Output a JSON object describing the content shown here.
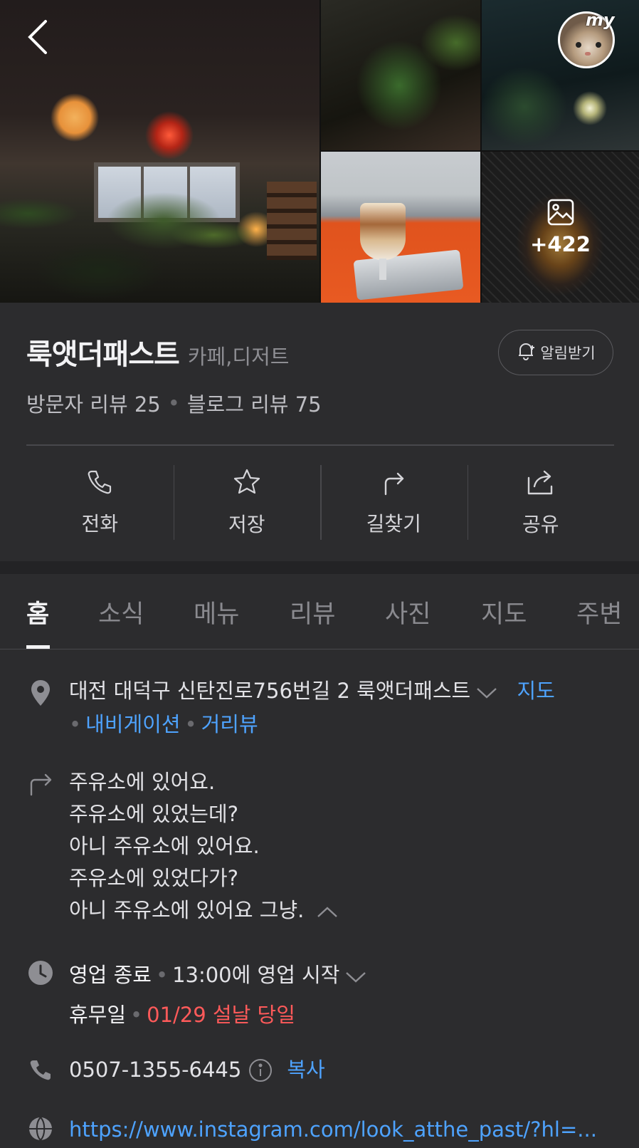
{
  "header": {
    "back_icon": "chevron-left-icon",
    "profile_badge": "my",
    "more_photos_count": "+422",
    "more_photos_icon": "image-icon"
  },
  "place": {
    "name": "룩앳더패스트",
    "category": "카페,디저트",
    "alarm_label": "알림받기",
    "visitor_reviews": "방문자 리뷰 25",
    "blog_reviews": "블로그 리뷰 75"
  },
  "actions": [
    {
      "label": "전화",
      "icon": "phone-icon"
    },
    {
      "label": "저장",
      "icon": "star-icon"
    },
    {
      "label": "길찾기",
      "icon": "directions-icon"
    },
    {
      "label": "공유",
      "icon": "share-icon"
    }
  ],
  "tabs": [
    {
      "label": "홈",
      "active": true
    },
    {
      "label": "소식"
    },
    {
      "label": "메뉴"
    },
    {
      "label": "리뷰"
    },
    {
      "label": "사진"
    },
    {
      "label": "지도"
    },
    {
      "label": "주변"
    }
  ],
  "address": {
    "text": "대전 대덕구 신탄진로756번길 2 룩앳더패스트",
    "map_link": "지도",
    "navigation_link": "내비게이션",
    "street_view_link": "거리뷰"
  },
  "directions": {
    "lines": [
      "주유소에 있어요.",
      "주유소에 있었는데?",
      "아니 주유소에 있어요.",
      "주유소에 있었다가?",
      "아니 주유소에 있어요 그냥."
    ]
  },
  "hours": {
    "status": "영업 종료",
    "next_open": "13:00에 영업 시작",
    "holiday_label": "휴무일",
    "holiday_value": "01/29 설날 당일"
  },
  "phone": {
    "number": "0507-1355-6445",
    "copy_label": "복사"
  },
  "website": {
    "url": "https://www.instagram.com/look_atthe_past/?hl=..."
  },
  "colors": {
    "background": "#2c2c2e",
    "link": "#4ea3ff",
    "holiday": "#ff5a5a"
  }
}
